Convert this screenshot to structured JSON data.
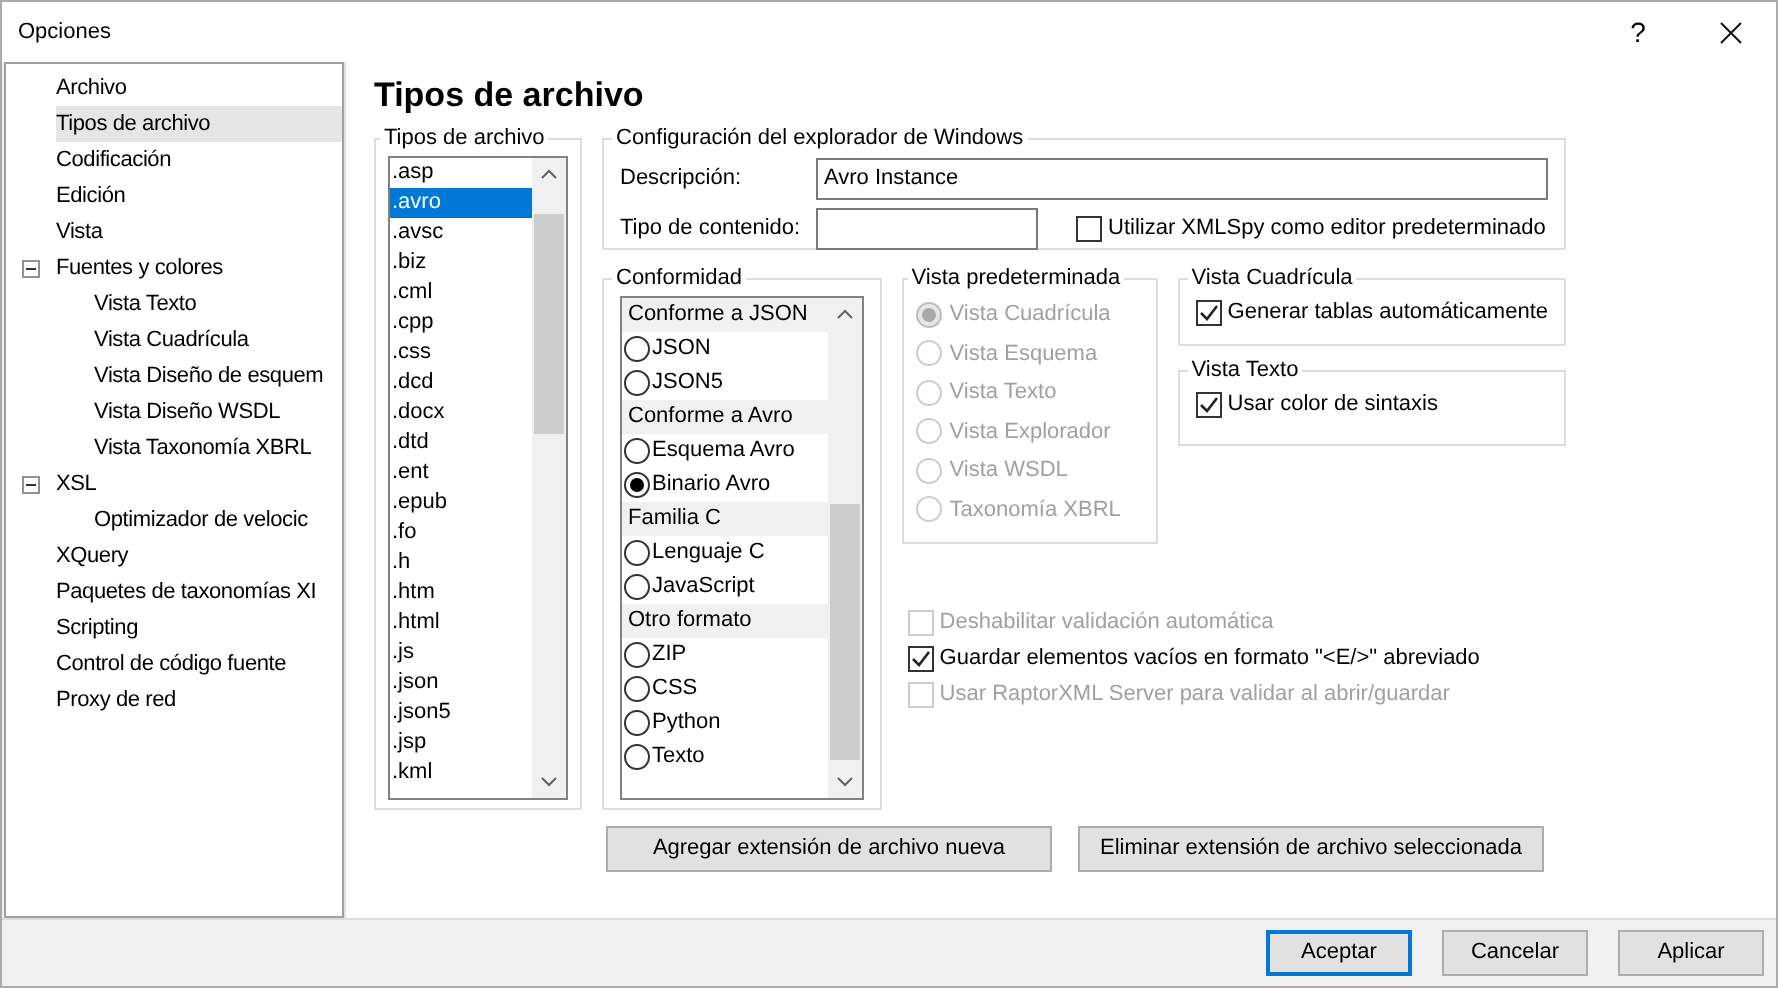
{
  "window": {
    "title": "Opciones",
    "help": "?"
  },
  "sidebar": {
    "items": [
      {
        "label": "Archivo",
        "selected": false
      },
      {
        "label": "Tipos de archivo",
        "selected": true
      },
      {
        "label": "Codificación",
        "selected": false
      },
      {
        "label": "Edición",
        "selected": false
      },
      {
        "label": "Vista",
        "selected": false
      },
      {
        "label": "Fuentes y colores",
        "selected": false,
        "expanded": true,
        "children": [
          {
            "label": "Vista Texto",
            "selected": false
          },
          {
            "label": "Vista Cuadrícula",
            "selected": false
          },
          {
            "label": "Vista Diseño de esquem",
            "selected": false
          },
          {
            "label": "Vista Diseño WSDL",
            "selected": false
          },
          {
            "label": "Vista Taxonomía XBRL",
            "selected": false
          }
        ]
      },
      {
        "label": "XSL",
        "selected": false,
        "expanded": true,
        "children": [
          {
            "label": "Optimizador de velocic",
            "selected": false
          }
        ]
      },
      {
        "label": "XQuery",
        "selected": false
      },
      {
        "label": "Paquetes de taxonomías XI",
        "selected": false
      },
      {
        "label": "Scripting",
        "selected": false
      },
      {
        "label": "Control de código fuente",
        "selected": false
      },
      {
        "label": "Proxy de red",
        "selected": false
      }
    ]
  },
  "page_title": "Tipos de archivo",
  "file_types": {
    "title": "Tipos de archivo",
    "items": [
      {
        "label": ".asp",
        "selected": false
      },
      {
        "label": ".avro",
        "selected": true
      },
      {
        "label": ".avsc",
        "selected": false
      },
      {
        "label": ".biz",
        "selected": false
      },
      {
        "label": ".cml",
        "selected": false
      },
      {
        "label": ".cpp",
        "selected": false
      },
      {
        "label": ".css",
        "selected": false
      },
      {
        "label": ".dcd",
        "selected": false
      },
      {
        "label": ".docx",
        "selected": false
      },
      {
        "label": ".dtd",
        "selected": false
      },
      {
        "label": ".ent",
        "selected": false
      },
      {
        "label": ".epub",
        "selected": false
      },
      {
        "label": ".fo",
        "selected": false
      },
      {
        "label": ".h",
        "selected": false
      },
      {
        "label": ".htm",
        "selected": false
      },
      {
        "label": ".html",
        "selected": false
      },
      {
        "label": ".js",
        "selected": false
      },
      {
        "label": ".json",
        "selected": false
      },
      {
        "label": ".json5",
        "selected": false
      },
      {
        "label": ".jsp",
        "selected": false
      },
      {
        "label": ".kml",
        "selected": false
      }
    ]
  },
  "explorer": {
    "title": "Configuración del explorador de Windows",
    "description_label": "Descripción:",
    "description": "Avro Instance",
    "content_type_label": "Tipo de contenido:",
    "default_editor": {
      "label": "Utilizar XMLSpy como editor predeterminado",
      "checked": false,
      "disabled": false
    }
  },
  "conformity": {
    "title": "Conformidad",
    "items": [
      {
        "kind": "header",
        "label": "Conforme a JSON"
      },
      {
        "kind": "radio",
        "label": "JSON",
        "selected": false
      },
      {
        "kind": "radio",
        "label": "JSON5",
        "selected": false
      },
      {
        "kind": "header",
        "label": "Conforme a Avro"
      },
      {
        "kind": "radio",
        "label": "Esquema Avro",
        "selected": false
      },
      {
        "kind": "radio",
        "label": "Binario Avro",
        "selected": true
      },
      {
        "kind": "header",
        "label": "Familia C"
      },
      {
        "kind": "radio",
        "label": "Lenguaje C",
        "selected": false
      },
      {
        "kind": "radio",
        "label": "JavaScript",
        "selected": false
      },
      {
        "kind": "header",
        "label": "Otro formato"
      },
      {
        "kind": "radio",
        "label": "ZIP",
        "selected": false
      },
      {
        "kind": "radio",
        "label": "CSS",
        "selected": false
      },
      {
        "kind": "radio",
        "label": "Python",
        "selected": false
      },
      {
        "kind": "radio",
        "label": "Texto",
        "selected": false
      }
    ]
  },
  "default_view": {
    "title": "Vista predeterminada",
    "disabled": true,
    "options": [
      {
        "label": "Vista Cuadrícula",
        "selected": true
      },
      {
        "label": "Vista Esquema",
        "selected": false
      },
      {
        "label": "Vista Texto",
        "selected": false
      },
      {
        "label": "Vista Explorador",
        "selected": false
      },
      {
        "label": "Vista WSDL",
        "selected": false
      },
      {
        "label": "Taxonomía XBRL",
        "selected": false
      }
    ]
  },
  "grid_view": {
    "title": "Vista Cuadrícula",
    "options": [
      {
        "label": "Generar tablas automáticamente",
        "checked": true,
        "disabled": false
      }
    ]
  },
  "text_view": {
    "title": "Vista Texto",
    "options": [
      {
        "label": "Usar color de sintaxis",
        "checked": true,
        "disabled": false
      }
    ]
  },
  "options": [
    {
      "label": "Deshabilitar validación automática",
      "checked": false,
      "disabled": true
    },
    {
      "label": "Guardar elementos vacíos en formato \"<E/>\" abreviado",
      "checked": true,
      "disabled": false
    },
    {
      "label": "Usar RaptorXML Server para validar al abrir/guardar",
      "checked": false,
      "disabled": true
    }
  ],
  "actions": [
    "Agregar extensión de archivo nueva",
    "Eliminar extensión de archivo seleccionada"
  ],
  "buttons": [
    {
      "label": "Aceptar",
      "selected": true
    },
    {
      "label": "Cancelar",
      "selected": false
    },
    {
      "label": "Aplicar",
      "selected": false
    }
  ]
}
